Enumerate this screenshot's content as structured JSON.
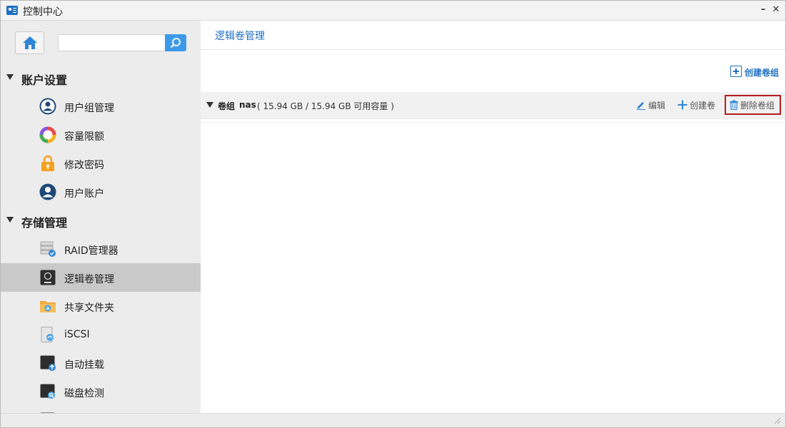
{
  "window": {
    "title": "控制中心",
    "minimize_label": "–",
    "close_label": "✕"
  },
  "sidebar": {
    "search_placeholder": "",
    "groups": [
      {
        "label": "账户设置",
        "items": [
          {
            "label": "用户组管理",
            "icon": "user-group-icon"
          },
          {
            "label": "容量限额",
            "icon": "quota-pie-icon"
          },
          {
            "label": "修改密码",
            "icon": "lock-icon"
          },
          {
            "label": "用户账户",
            "icon": "user-account-icon"
          }
        ]
      },
      {
        "label": "存储管理",
        "items": [
          {
            "label": "RAID管理器",
            "icon": "raid-icon"
          },
          {
            "label": "逻辑卷管理",
            "icon": "lvm-icon",
            "active": true
          },
          {
            "label": "共享文件夹",
            "icon": "shared-folder-icon"
          },
          {
            "label": "iSCSI",
            "icon": "iscsi-icon"
          },
          {
            "label": "自动挂载",
            "icon": "auto-mount-icon"
          },
          {
            "label": "磁盘检测",
            "icon": "disk-check-icon"
          }
        ]
      }
    ]
  },
  "main": {
    "title": "逻辑卷管理",
    "create_group_label": "创建卷组",
    "volume_group": {
      "label": "卷组",
      "name": "nas",
      "capacity_text": "( 15.94 GB / 15.94 GB 可用容量 )",
      "actions": {
        "edit": "编辑",
        "create_volume": "创建卷",
        "delete_group": "删除卷组"
      }
    }
  },
  "colors": {
    "accent": "#1f6fc0",
    "search_button": "#3d9ae8",
    "active_item": "#c9c9c9",
    "highlight_border": "#b71c1c"
  }
}
